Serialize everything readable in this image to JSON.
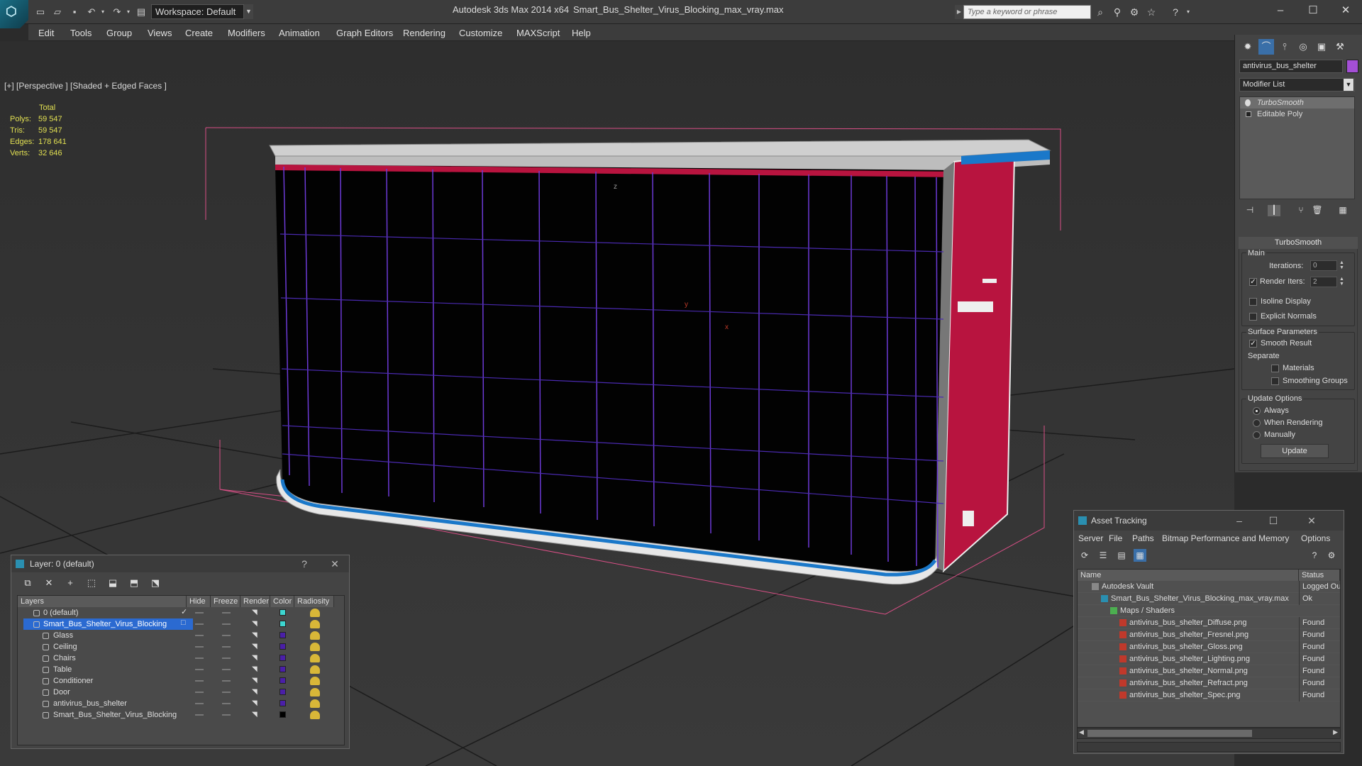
{
  "app": {
    "title": "Autodesk 3ds Max 2014 x64",
    "file": "Smart_Bus_Shelter_Virus_Blocking_max_vray.max",
    "workspace": "Workspace: Default",
    "search_placeholder": "Type a keyword or phrase"
  },
  "menu": [
    "Edit",
    "Tools",
    "Group",
    "Views",
    "Create",
    "Modifiers",
    "Animation",
    "Graph Editors",
    "Rendering",
    "Customize",
    "MAXScript",
    "Help"
  ],
  "viewport": {
    "label": "[+] [Perspective ] [Shaded + Edged Faces ]",
    "stats_header": "Total",
    "stats": [
      {
        "label": "Polys:",
        "value": "59 547"
      },
      {
        "label": "Tris:",
        "value": "59 547"
      },
      {
        "label": "Edges:",
        "value": "178 641"
      },
      {
        "label": "Verts:",
        "value": "32 646"
      }
    ],
    "axes": {
      "x": "x",
      "y": "y",
      "z": "z"
    }
  },
  "command_panel": {
    "object_name": "antivirus_bus_shelter",
    "object_color": "#a44fd6",
    "modifier_list": "Modifier List",
    "stack": [
      {
        "name": "TurboSmooth",
        "selected": true
      },
      {
        "name": "Editable Poly",
        "selected": false
      }
    ],
    "turbosmooth": {
      "title": "TurboSmooth",
      "main": "Main",
      "iterations_label": "Iterations:",
      "iterations": "0",
      "render_iters_label": "Render Iters:",
      "render_iters": "2",
      "render_iters_checked": true,
      "isoline": "Isoline Display",
      "explicit_normals": "Explicit Normals",
      "surface_params": "Surface Parameters",
      "smooth_result": "Smooth Result",
      "separate": "Separate",
      "materials": "Materials",
      "smoothing_groups": "Smoothing Groups",
      "update_options": "Update Options",
      "always": "Always",
      "when_rendering": "When Rendering",
      "manually": "Manually",
      "update": "Update"
    }
  },
  "layer_window": {
    "title": "Layer: 0 (default)",
    "help": "?",
    "close": "✕",
    "columns": [
      "Layers",
      "Hide",
      "Freeze",
      "Render",
      "Color",
      "Radiosity"
    ],
    "rows": [
      {
        "name": "0 (default)",
        "color": "#3dd6d0",
        "selected": false,
        "indent": 0,
        "active": true
      },
      {
        "name": "Smart_Bus_Shelter_Virus_Blocking",
        "color": "#3dd6d0",
        "selected": true,
        "indent": 0,
        "active": false
      },
      {
        "name": "Glass",
        "color": "#4a1fa8",
        "selected": false,
        "indent": 1
      },
      {
        "name": "Ceiling",
        "color": "#4a1fa8",
        "selected": false,
        "indent": 1
      },
      {
        "name": "Chairs",
        "color": "#4a1fa8",
        "selected": false,
        "indent": 1
      },
      {
        "name": "Table",
        "color": "#4a1fa8",
        "selected": false,
        "indent": 1
      },
      {
        "name": "Conditioner",
        "color": "#4a1fa8",
        "selected": false,
        "indent": 1
      },
      {
        "name": "Door",
        "color": "#4a1fa8",
        "selected": false,
        "indent": 1
      },
      {
        "name": "antivirus_bus_shelter",
        "color": "#4a1fa8",
        "selected": false,
        "indent": 1
      },
      {
        "name": "Smart_Bus_Shelter_Virus_Blocking",
        "color": "#000000",
        "selected": false,
        "indent": 1
      }
    ]
  },
  "asset_window": {
    "title": "Asset Tracking",
    "menu": [
      "Server",
      "File",
      "Paths",
      "Bitmap Performance and Memory",
      "Options"
    ],
    "columns": [
      "Name",
      "Status"
    ],
    "rows": [
      {
        "name": "Autodesk Vault",
        "status": "Logged Ou",
        "level": 0,
        "icon": "vault"
      },
      {
        "name": "Smart_Bus_Shelter_Virus_Blocking_max_vray.max",
        "status": "Ok",
        "level": 1,
        "icon": "max"
      },
      {
        "name": "Maps / Shaders",
        "status": "",
        "level": 2,
        "icon": "maps"
      },
      {
        "name": "antivirus_bus_shelter_Diffuse.png",
        "status": "Found",
        "level": 3,
        "icon": "png"
      },
      {
        "name": "antivirus_bus_shelter_Fresnel.png",
        "status": "Found",
        "level": 3,
        "icon": "png"
      },
      {
        "name": "antivirus_bus_shelter_Gloss.png",
        "status": "Found",
        "level": 3,
        "icon": "png"
      },
      {
        "name": "antivirus_bus_shelter_Lighting.png",
        "status": "Found",
        "level": 3,
        "icon": "png"
      },
      {
        "name": "antivirus_bus_shelter_Normal.png",
        "status": "Found",
        "level": 3,
        "icon": "png"
      },
      {
        "name": "antivirus_bus_shelter_Refract.png",
        "status": "Found",
        "level": 3,
        "icon": "png"
      },
      {
        "name": "antivirus_bus_shelter_Spec.png",
        "status": "Found",
        "level": 3,
        "icon": "png"
      }
    ]
  }
}
